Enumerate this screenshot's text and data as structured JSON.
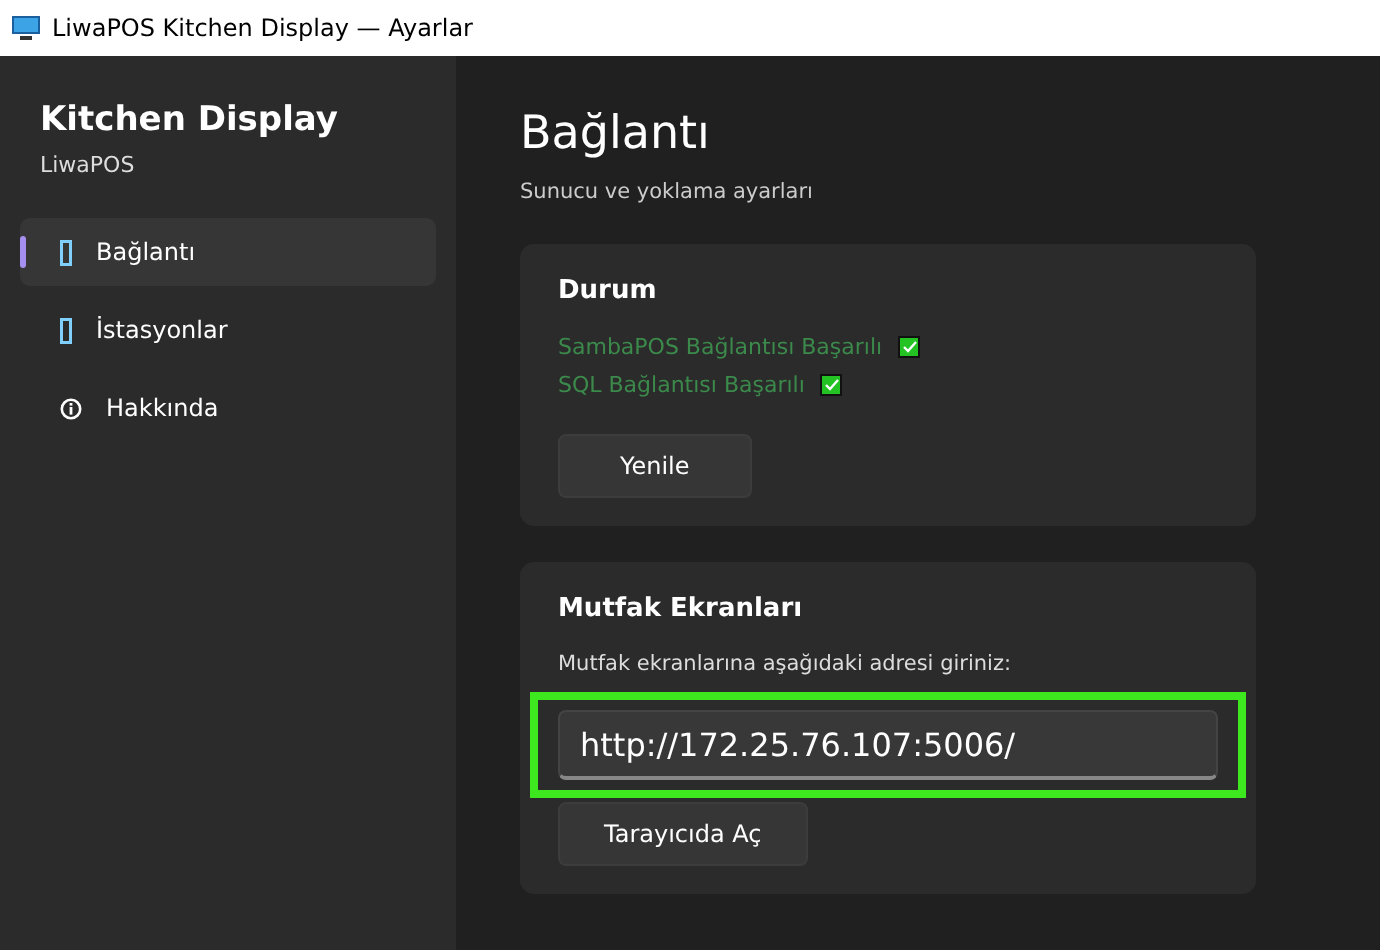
{
  "window": {
    "title": "LiwaPOS Kitchen Display — Ayarlar"
  },
  "sidebar": {
    "title": "Kitchen Display",
    "subtitle": "LiwaPOS",
    "items": [
      {
        "label": "Bağlantı",
        "kind": "box",
        "selected": true
      },
      {
        "label": "İstasyonlar",
        "kind": "box",
        "selected": false
      },
      {
        "label": "Hakkında",
        "kind": "info",
        "selected": false
      }
    ]
  },
  "page": {
    "title": "Bağlantı",
    "subtitle": "Sunucu ve yoklama ayarları"
  },
  "status_card": {
    "title": "Durum",
    "checks": [
      {
        "label": "SambaPOS Bağlantısı Başarılı",
        "checked": true
      },
      {
        "label": "SQL Bağlantısı Başarılı",
        "checked": true
      }
    ],
    "button": "Yenile"
  },
  "kitchen_card": {
    "title": "Mutfak Ekranları",
    "hint": "Mutfak ekranlarına aşağıdaki adresi giriniz:",
    "url": "http://172.25.76.107:5006/",
    "highlighted": true,
    "button": "Tarayıcıda Aç"
  }
}
